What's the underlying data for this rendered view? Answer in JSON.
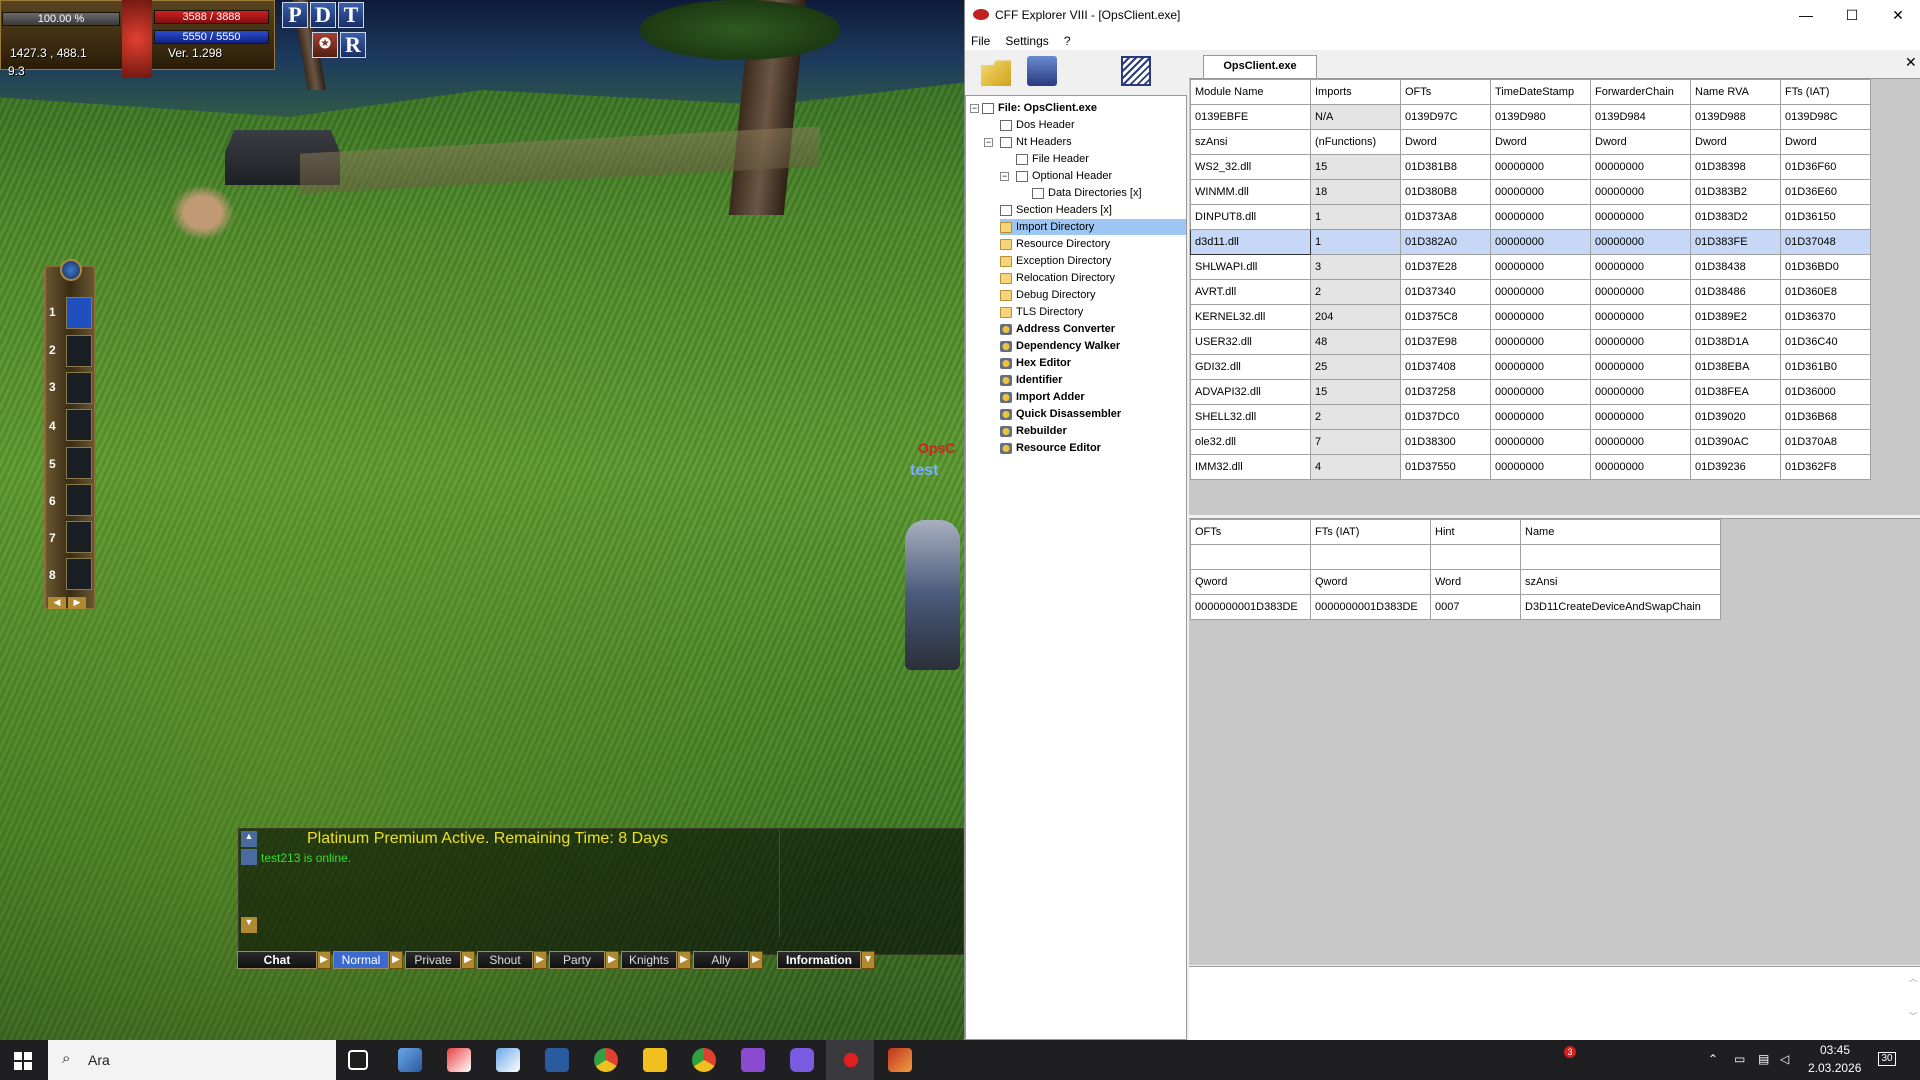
{
  "game": {
    "hp_pct": "100.00 %",
    "hp": "3588 / 3888",
    "mp": "5550 / 5550",
    "coords": "1427.3 , 488.1",
    "ver": "Ver. 1.298",
    "zone": "9.3",
    "pdt": [
      "P",
      "D",
      "T"
    ],
    "r_label": "R",
    "slots": [
      "1",
      "2",
      "3",
      "4",
      "5",
      "6",
      "7",
      "8"
    ],
    "right_name": "OpsC",
    "right_name2": "test",
    "notice": "Platinum Premium Active. Remaining Time: 8 Days",
    "online": "test213 is online.",
    "chat_buttons": [
      "Chat",
      "Normal",
      "Private",
      "Shout",
      "Party",
      "Knights",
      "Ally",
      "Information"
    ]
  },
  "cff": {
    "title": "CFF Explorer VIII - [OpsClient.exe]",
    "menu": [
      "File",
      "Settings",
      "?"
    ],
    "tab": "OpsClient.exe",
    "tree": [
      {
        "label": "File: OpsClient.exe",
        "bold": true
      },
      {
        "label": "Dos Header"
      },
      {
        "label": "Nt Headers"
      },
      {
        "label": "File Header"
      },
      {
        "label": "Optional Header"
      },
      {
        "label": "Data Directories [x]"
      },
      {
        "label": "Section Headers [x]"
      },
      {
        "label": "Import Directory"
      },
      {
        "label": "Resource Directory"
      },
      {
        "label": "Exception Directory"
      },
      {
        "label": "Relocation Directory"
      },
      {
        "label": "Debug Directory"
      },
      {
        "label": "TLS Directory"
      },
      {
        "label": "Address Converter",
        "bold": true
      },
      {
        "label": "Dependency Walker",
        "bold": true
      },
      {
        "label": "Hex Editor",
        "bold": true
      },
      {
        "label": "Identifier",
        "bold": true
      },
      {
        "label": "Import Adder",
        "bold": true
      },
      {
        "label": "Quick Disassembler",
        "bold": true
      },
      {
        "label": "Rebuilder",
        "bold": true
      },
      {
        "label": "Resource Editor",
        "bold": true
      }
    ],
    "upper_headers": [
      "Module Name",
      "Imports",
      "OFTs",
      "TimeDateStamp",
      "ForwarderChain",
      "Name RVA",
      "FTs (IAT)"
    ],
    "upper_addr": [
      "0139EBFE",
      "N/A",
      "0139D97C",
      "0139D980",
      "0139D984",
      "0139D988",
      "0139D98C"
    ],
    "upper_types": [
      "szAnsi",
      "(nFunctions)",
      "Dword",
      "Dword",
      "Dword",
      "Dword",
      "Dword"
    ],
    "upper_rows": [
      [
        "WS2_32.dll",
        "15",
        "01D381B8",
        "00000000",
        "00000000",
        "01D38398",
        "01D36F60"
      ],
      [
        "WINMM.dll",
        "18",
        "01D380B8",
        "00000000",
        "00000000",
        "01D383B2",
        "01D36E60"
      ],
      [
        "DINPUT8.dll",
        "1",
        "01D373A8",
        "00000000",
        "00000000",
        "01D383D2",
        "01D36150"
      ],
      [
        "d3d11.dll",
        "1",
        "01D382A0",
        "00000000",
        "00000000",
        "01D383FE",
        "01D37048"
      ],
      [
        "SHLWAPI.dll",
        "3",
        "01D37E28",
        "00000000",
        "00000000",
        "01D38438",
        "01D36BD0"
      ],
      [
        "AVRT.dll",
        "2",
        "01D37340",
        "00000000",
        "00000000",
        "01D38486",
        "01D360E8"
      ],
      [
        "KERNEL32.dll",
        "204",
        "01D375C8",
        "00000000",
        "00000000",
        "01D389E2",
        "01D36370"
      ],
      [
        "USER32.dll",
        "48",
        "01D37E98",
        "00000000",
        "00000000",
        "01D38D1A",
        "01D36C40"
      ],
      [
        "GDI32.dll",
        "25",
        "01D37408",
        "00000000",
        "00000000",
        "01D38EBA",
        "01D361B0"
      ],
      [
        "ADVAPI32.dll",
        "15",
        "01D37258",
        "00000000",
        "00000000",
        "01D38FEA",
        "01D36000"
      ],
      [
        "SHELL32.dll",
        "2",
        "01D37DC0",
        "00000000",
        "00000000",
        "01D39020",
        "01D36B68"
      ],
      [
        "ole32.dll",
        "7",
        "01D38300",
        "00000000",
        "00000000",
        "01D390AC",
        "01D370A8"
      ],
      [
        "IMM32.dll",
        "4",
        "01D37550",
        "00000000",
        "00000000",
        "01D39236",
        "01D362F8"
      ]
    ],
    "lower_headers": [
      "OFTs",
      "FTs (IAT)",
      "Hint",
      "Name"
    ],
    "lower_blank": [
      "",
      "",
      "",
      ""
    ],
    "lower_types": [
      "Qword",
      "Qword",
      "Word",
      "szAnsi"
    ],
    "lower_rows": [
      [
        "0000000001D383DE",
        "0000000001D383DE",
        "0007",
        "D3D11CreateDeviceAndSwapChain"
      ]
    ]
  },
  "taskbar": {
    "search": "Ara",
    "time": "03:45",
    "date": "2.03.2026",
    "badge": "3",
    "notif": "30"
  }
}
